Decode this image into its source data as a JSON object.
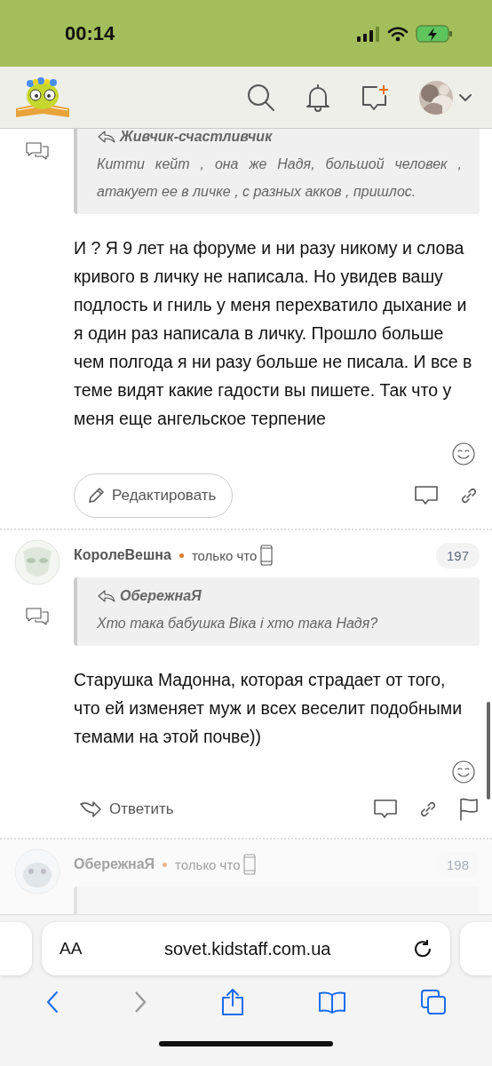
{
  "status_bar": {
    "time": "00:14"
  },
  "posts": [
    {
      "dimmed": false,
      "quote": {
        "author": "Живчик-счастливчик",
        "text": "Китти кейт , она же Надя, большой человек , атакует ее в личке , с разных акков , пришлос."
      },
      "body": "И ? Я 9 лет на форуме и ни разу никому и слова кривого в личку не написала. Но увидев вашу подлость и гниль у меня перехватило дыхание и я один раз написала в личку. Прошло больше чем полгода я ни разу больше не писала. И все в теме видят какие гадости вы пишете. Так что у меня еще ангельское терпение",
      "action": {
        "kind": "edit",
        "label": "Редактировать"
      }
    },
    {
      "dimmed": false,
      "header": {
        "author": "КоролеВешна",
        "online": true,
        "time": "только что",
        "number": "197"
      },
      "quote": {
        "author": "ОбережнаЯ",
        "text": "Хто така бабушка Віка і хто така Надя?"
      },
      "body": "Старушка Мадонна, которая страдает от того, что ей изменяет муж и всех веселит подобными темами на этой почве))",
      "action": {
        "kind": "reply",
        "label": "Ответить"
      }
    },
    {
      "dimmed": true,
      "header": {
        "author": "ОбережнаЯ",
        "online": true,
        "time": "только что",
        "number": "198"
      }
    }
  ],
  "browser": {
    "text_size": "AA",
    "url": "sovet.kidstaff.com.ua"
  }
}
